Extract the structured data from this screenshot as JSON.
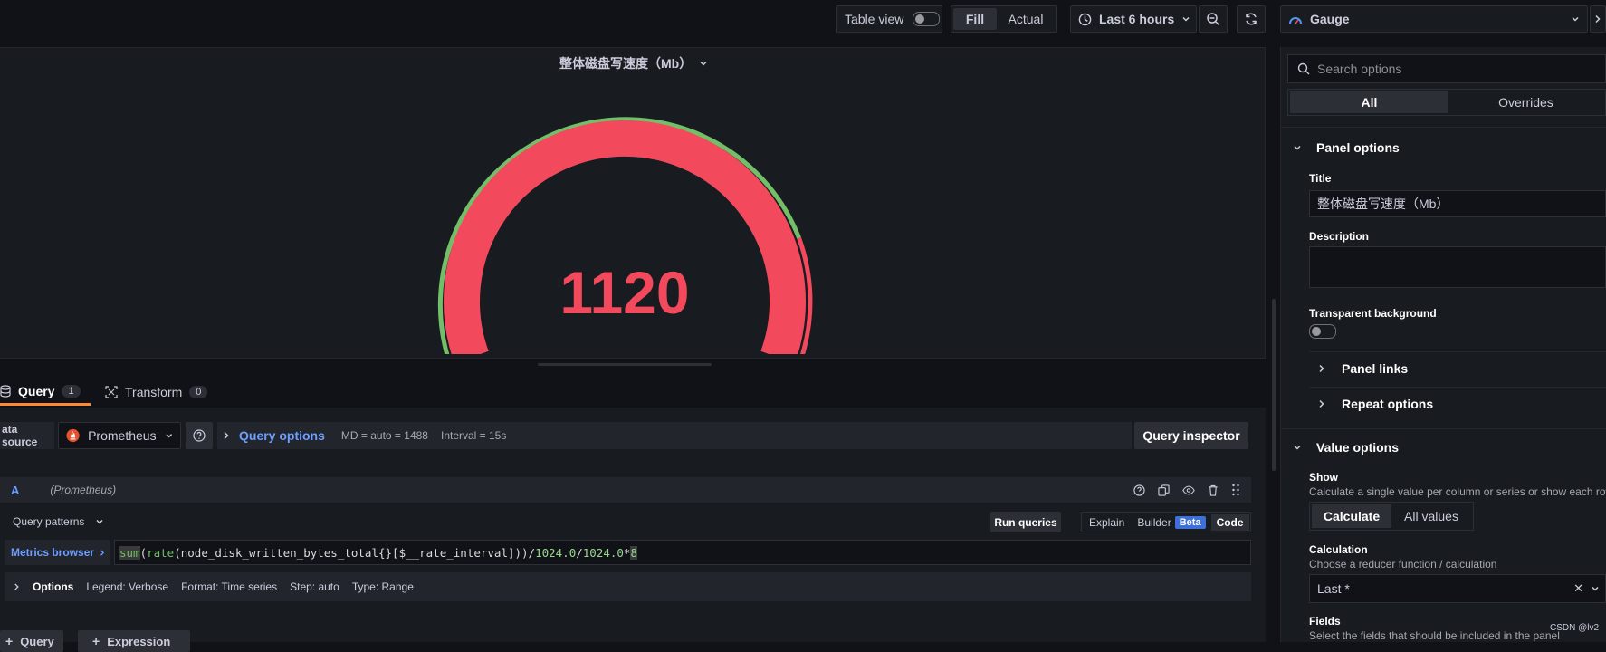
{
  "toolbar": {
    "table_view_label": "Table view",
    "fill_label": "Fill",
    "actual_label": "Actual",
    "time_range": "Last 6 hours"
  },
  "visualization_picker": {
    "selected": "Gauge"
  },
  "panel": {
    "title": "整体磁盘写速度（Mb）",
    "gauge_value": "1120",
    "gauge_color": "#f2495c",
    "threshold_color": "#73bf69"
  },
  "tabs": {
    "query_label": "Query",
    "query_count": "1",
    "transform_label": "Transform",
    "transform_count": "0"
  },
  "datasource_row": {
    "label": "ata source",
    "datasource": "Prometheus",
    "query_options_label": "Query options",
    "md_info": "MD = auto = 1488",
    "interval_info": "Interval = 15s",
    "query_inspector_label": "Query inspector"
  },
  "query_a": {
    "ref_id": "A",
    "datasource_hint": "(Prometheus)",
    "patterns_label": "Query patterns",
    "run_queries_label": "Run queries",
    "explain_label": "Explain",
    "builder_label": "Builder",
    "beta_label": "Beta",
    "code_label": "Code",
    "metrics_browser_label": "Metrics browser",
    "expr_sum": "sum",
    "expr_p1": "(",
    "expr_rate": "rate",
    "expr_p2": "(node_disk_written_bytes_total{}[$__rate_interval]))/",
    "expr_n1": "1024.0",
    "expr_p3": "/",
    "expr_n2": "1024.0",
    "expr_p4": "*",
    "expr_n3": "8",
    "options_label": "Options",
    "legend_info": "Legend: Verbose",
    "format_info": "Format: Time series",
    "step_info": "Step: auto",
    "type_info": "Type: Range"
  },
  "bottom_buttons": {
    "query_label": "Query",
    "expression_label": "Expression"
  },
  "options_pane": {
    "search_placeholder": "Search options",
    "all_tab": "All",
    "overrides_tab": "Overrides",
    "panel_options_header": "Panel options",
    "title_label": "Title",
    "title_value": "整体磁盘写速度（Mb）",
    "description_label": "Description",
    "transparent_label": "Transparent background",
    "panel_links_label": "Panel links",
    "repeat_options_label": "Repeat options",
    "value_options_header": "Value options",
    "show_label": "Show",
    "show_desc": "Calculate a single value per column or series or show each row",
    "calculate_label": "Calculate",
    "all_values_label": "All values",
    "calculation_label": "Calculation",
    "calculation_desc": "Choose a reducer function / calculation",
    "calculation_value": "Last *",
    "fields_label": "Fields",
    "fields_desc": "Select the fields that should be included in the panel"
  },
  "watermark": "CSDN @lv2"
}
